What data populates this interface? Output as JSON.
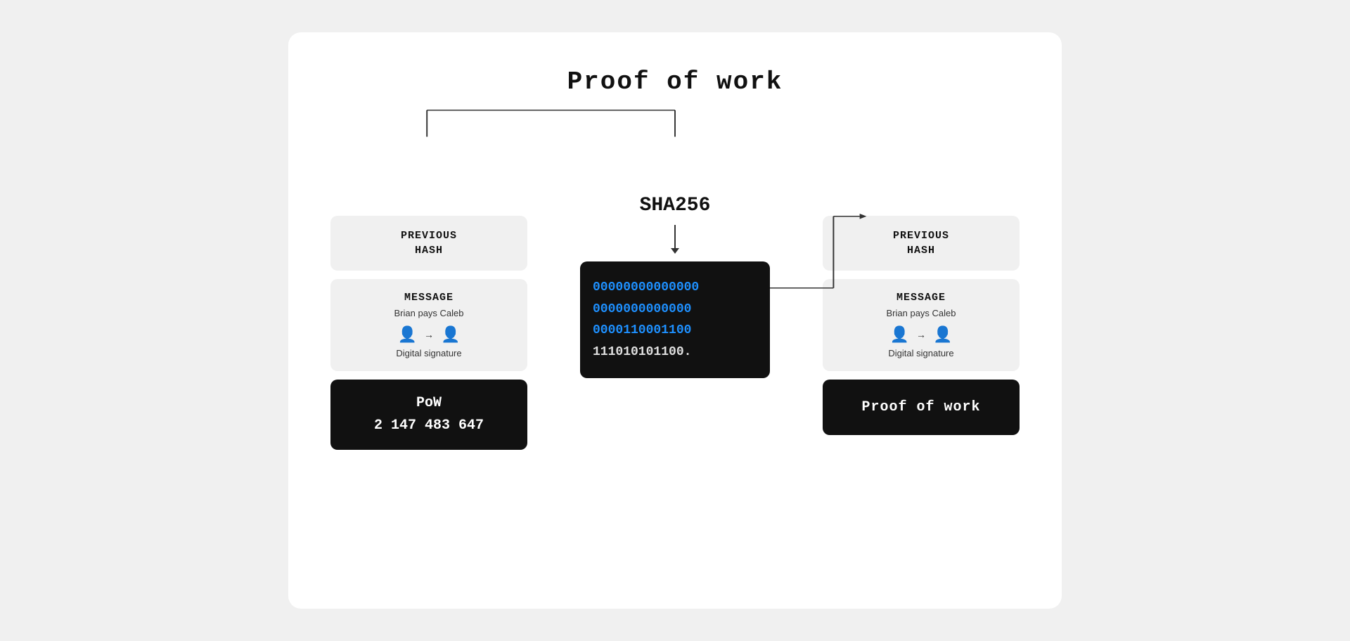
{
  "title": "Proof of work",
  "sha_label": "SHA256",
  "left": {
    "previous_hash_label": "PREVIOUS\nHASH",
    "message_title": "MESSAGE",
    "message_sub": "Brian pays Caleb",
    "digital_sig": "Digital signature",
    "pow_title": "PoW",
    "pow_value": "2 147 483 647"
  },
  "center": {
    "hash_lines": [
      "00000000000000",
      "0000000000000",
      "0000110001100",
      "111010101100."
    ]
  },
  "right": {
    "previous_hash_label": "PREVIOUS\nHASH",
    "message_title": "MESSAGE",
    "message_sub": "Brian pays Caleb",
    "digital_sig": "Digital signature",
    "proof_label": "Proof of work"
  }
}
